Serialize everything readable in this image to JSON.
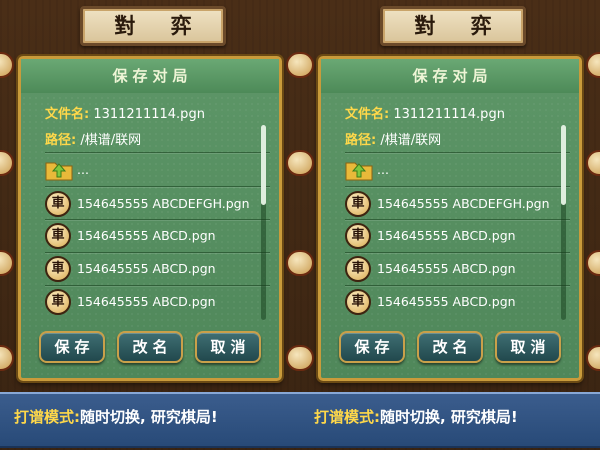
{
  "header": {
    "title": "對 弈"
  },
  "dialog": {
    "title": "保存对局",
    "filename_label": "文件名:",
    "filename_value": "1311211114.pgn",
    "path_label": "路径:",
    "path_value": "/棋谱/联网",
    "parent_dir": "...",
    "items": [
      {
        "icon": "車",
        "name": "154645555 ABCDEFGH.pgn"
      },
      {
        "icon": "車",
        "name": "154645555 ABCD.pgn"
      },
      {
        "icon": "車",
        "name": "154645555 ABCD.pgn"
      },
      {
        "icon": "車",
        "name": "154645555 ABCD.pgn"
      }
    ],
    "buttons": {
      "save": "保存",
      "rename": "改名",
      "cancel": "取消"
    }
  },
  "banner": {
    "highlight": "打谱模式:",
    "rest": "随时切换, 研究棋局!"
  },
  "colors": {
    "dialog_green": "#5d9667",
    "gold_border": "#c99b3b",
    "label_yellow": "#ffd84a",
    "banner_blue": "#2f5282"
  }
}
